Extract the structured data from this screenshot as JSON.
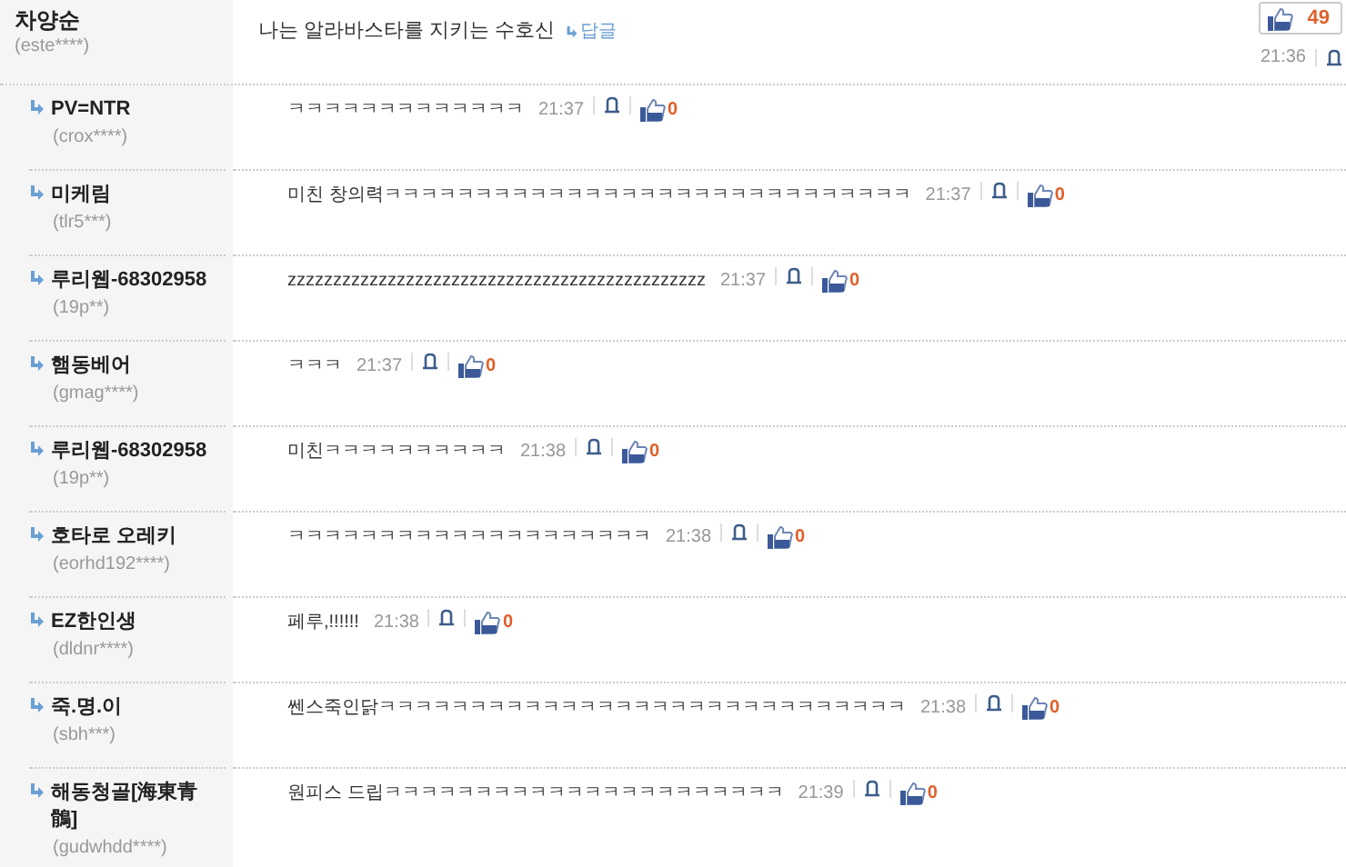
{
  "comment": {
    "author": "차양순",
    "user_id": "(este****)",
    "text": "나는 알라바스타를 지키는 수호신",
    "reply_link": "답글",
    "likes": "49",
    "time": "21:36"
  },
  "replies": [
    {
      "author": "PV=NTR",
      "user_id": "(crox****)",
      "text": "ㅋㅋㅋㅋㅋㅋㅋㅋㅋㅋㅋㅋㅋ",
      "time": "21:37",
      "likes": "0"
    },
    {
      "author": "미케림",
      "user_id": "(tlr5***)",
      "text": "미친 창의력ㅋㅋㅋㅋㅋㅋㅋㅋㅋㅋㅋㅋㅋㅋㅋㅋㅋㅋㅋㅋㅋㅋㅋㅋㅋㅋㅋㅋㅋ",
      "time": "21:37",
      "likes": "0"
    },
    {
      "author": "루리웹-68302958",
      "user_id": "(19p**)",
      "text": "zzzzzzzzzzzzzzzzzzzzzzzzzzzzzzzzzzzzzzzzzzzzzz",
      "time": "21:37",
      "likes": "0"
    },
    {
      "author": "햄동베어",
      "user_id": "(gmag****)",
      "text": "ㅋㅋㅋ",
      "time": "21:37",
      "likes": "0"
    },
    {
      "author": "루리웹-68302958",
      "user_id": "(19p**)",
      "text": "미친ㅋㅋㅋㅋㅋㅋㅋㅋㅋㅋ",
      "time": "21:38",
      "likes": "0"
    },
    {
      "author": "호타로 오레키",
      "user_id": "(eorhd192****)",
      "text": "ㅋㅋㅋㅋㅋㅋㅋㅋㅋㅋㅋㅋㅋㅋㅋㅋㅋㅋㅋㅋ",
      "time": "21:38",
      "likes": "0"
    },
    {
      "author": "EZ한인생",
      "user_id": "(dldnr****)",
      "text": "페루,!!!!!!",
      "time": "21:38",
      "likes": "0"
    },
    {
      "author": "죽.명.이",
      "user_id": "(sbh***)",
      "text": "쎈스죽인닭ㅋㅋㅋㅋㅋㅋㅋㅋㅋㅋㅋㅋㅋㅋㅋㅋㅋㅋㅋㅋㅋㅋㅋㅋㅋㅋㅋㅋㅋ",
      "time": "21:38",
      "likes": "0"
    },
    {
      "author": "해동청골[海東青鶻]",
      "user_id": "(gudwhdd****)",
      "text": "원피스 드립ㅋㅋㅋㅋㅋㅋㅋㅋㅋㅋㅋㅋㅋㅋㅋㅋㅋㅋㅋㅋㅋㅋ",
      "time": "21:39",
      "likes": "0"
    }
  ]
}
